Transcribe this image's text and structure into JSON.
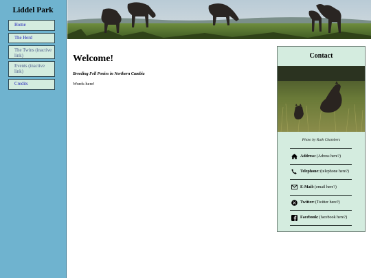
{
  "sidebar": {
    "title": "Liddel Park",
    "items": [
      {
        "label": "Home"
      },
      {
        "label": "The Herd"
      },
      {
        "label": "The Twins (inactive link)"
      },
      {
        "label": "Events (inactive link)"
      },
      {
        "label": "Credits"
      }
    ]
  },
  "main": {
    "title": "Welcome!",
    "tagline": "Breeding Fell Ponies in Northern Cumbia",
    "body": "Words here!"
  },
  "contact": {
    "title": "Contact",
    "photo_credit": "Photo by Ruth Chambers",
    "rows": [
      {
        "icon": "home-icon",
        "label": "Address:",
        "value": "(Adress here?)"
      },
      {
        "icon": "phone-icon",
        "label": "Telephone:",
        "value": "(telephone here?)"
      },
      {
        "icon": "envelope-icon",
        "label": "E-Mail:",
        "value": "(email here?)"
      },
      {
        "icon": "x-twitter-icon",
        "label": "Twitter:",
        "value": "(Twitter here?)"
      },
      {
        "icon": "facebook-icon",
        "label": "Facebook:",
        "value": "(facebook here?)"
      }
    ]
  }
}
